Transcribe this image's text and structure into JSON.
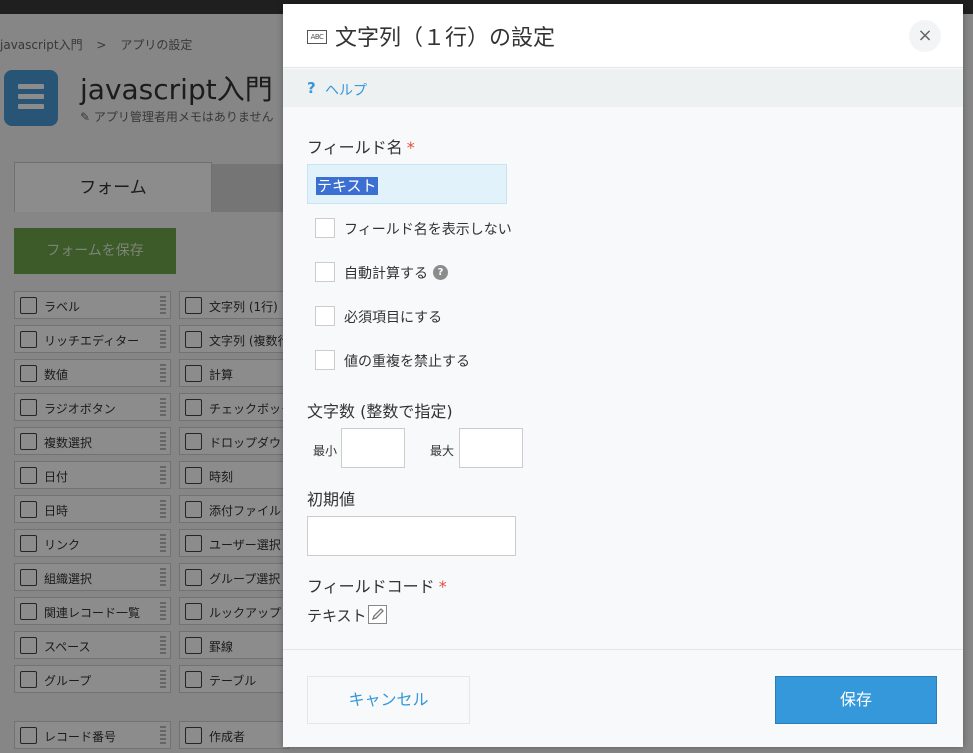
{
  "background": {
    "breadcrumb": [
      "javascript入門",
      ">",
      "アプリの設定"
    ],
    "app_title": "javascript入門",
    "app_memo": "アプリ管理者用メモはありません",
    "tab_form": "フォーム",
    "save_form_button": "フォームを保存",
    "palette_left": [
      {
        "label": "ラベル",
        "icon": "tag-icon"
      },
      {
        "label": "リッチエディター",
        "icon": "rich-editor-icon"
      },
      {
        "label": "数値",
        "icon": "number-icon"
      },
      {
        "label": "ラジオボタン",
        "icon": "radio-icon"
      },
      {
        "label": "複数選択",
        "icon": "multi-select-icon"
      },
      {
        "label": "日付",
        "icon": "calendar-icon"
      },
      {
        "label": "日時",
        "icon": "datetime-icon"
      },
      {
        "label": "リンク",
        "icon": "link-icon"
      },
      {
        "label": "組織選択",
        "icon": "org-icon"
      },
      {
        "label": "関連レコード一覧",
        "icon": "related-records-icon"
      },
      {
        "label": "スペース",
        "icon": "space-icon"
      },
      {
        "label": "グループ",
        "icon": "group-icon"
      },
      {
        "label": "レコード番号",
        "icon": "record-number-icon"
      }
    ],
    "palette_right": [
      {
        "label": "文字列 (1行)",
        "icon": "abc-icon"
      },
      {
        "label": "文字列 (複数行",
        "icon": "multiline-text-icon"
      },
      {
        "label": "計算",
        "icon": "calc-icon"
      },
      {
        "label": "チェックボック",
        "icon": "checkbox-icon"
      },
      {
        "label": "ドロップダウン",
        "icon": "dropdown-icon"
      },
      {
        "label": "時刻",
        "icon": "clock-icon"
      },
      {
        "label": "添付ファイル",
        "icon": "paperclip-icon"
      },
      {
        "label": "ユーザー選択",
        "icon": "user-icon"
      },
      {
        "label": "グループ選択",
        "icon": "users-icon"
      },
      {
        "label": "ルックアップ",
        "icon": "lookup-icon"
      },
      {
        "label": "罫線",
        "icon": "line-icon"
      },
      {
        "label": "テーブル",
        "icon": "table-icon"
      },
      {
        "label": "作成者",
        "icon": "creator-icon"
      }
    ]
  },
  "dialog": {
    "title": "文字列（１行）の設定",
    "title_icon_text": "ABC",
    "close_symbol": "×",
    "help_icon": "?",
    "help_link": "ヘルプ",
    "field_name_label": "フィールド名",
    "required_mark": "*",
    "field_name_value": "テキスト",
    "checkboxes": [
      {
        "label": "フィールド名を表示しない",
        "checked": false
      },
      {
        "label": "自動計算する",
        "checked": false
      },
      {
        "label": "必須項目にする",
        "checked": false
      },
      {
        "label": "値の重複を禁止する",
        "checked": false
      }
    ],
    "char_count_label": "文字数 (整数で指定)",
    "min_label": "最小",
    "max_label": "最大",
    "min_value": "",
    "max_value": "",
    "default_label": "初期値",
    "default_value": "",
    "field_code_label": "フィールドコード",
    "field_code_value": "テキスト",
    "cancel_button": "キャンセル",
    "save_button": "保存",
    "colors": {
      "primary": "#3498db",
      "required": "#e74c3c",
      "selection": "#3b6fd1"
    }
  }
}
